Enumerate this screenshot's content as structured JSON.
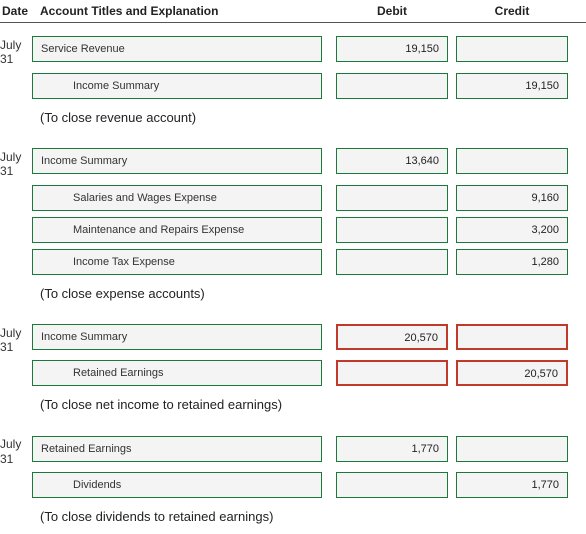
{
  "headers": {
    "date": "Date",
    "acct": "Account Titles and Explanation",
    "debit": "Debit",
    "credit": "Credit"
  },
  "groups": [
    {
      "date": "July 31",
      "caption": "(To close revenue account)",
      "lines": [
        {
          "title": "Service Revenue",
          "indent": 0,
          "debit": "19,150",
          "credit": "",
          "error": false
        },
        {
          "title": "Income Summary",
          "indent": 1,
          "debit": "",
          "credit": "19,150",
          "error": false
        }
      ]
    },
    {
      "date": "July 31",
      "caption": "(To close expense accounts)",
      "lines": [
        {
          "title": "Income Summary",
          "indent": 0,
          "debit": "13,640",
          "credit": "",
          "error": false
        },
        {
          "title": "Salaries and Wages Expense",
          "indent": 1,
          "debit": "",
          "credit": "9,160",
          "error": false
        },
        {
          "title": "Maintenance and Repairs Expense",
          "indent": 1,
          "debit": "",
          "credit": "3,200",
          "error": false
        },
        {
          "title": "Income Tax Expense",
          "indent": 1,
          "debit": "",
          "credit": "1,280",
          "error": false
        }
      ]
    },
    {
      "date": "July 31",
      "caption": "(To close net income to retained earnings)",
      "lines": [
        {
          "title": "Income Summary",
          "indent": 0,
          "debit": "20,570",
          "credit": "",
          "error": true
        },
        {
          "title": "Retained Earnings",
          "indent": 1,
          "debit": "",
          "credit": "20,570",
          "error": true
        }
      ]
    },
    {
      "date": "July 31",
      "caption": "(To close dividends to retained earnings)",
      "lines": [
        {
          "title": "Retained Earnings",
          "indent": 0,
          "debit": "1,770",
          "credit": "",
          "error": false
        },
        {
          "title": "Dividends",
          "indent": 1,
          "debit": "",
          "credit": "1,770",
          "error": false
        }
      ]
    }
  ],
  "chart_data": {
    "type": "table",
    "title": "Closing Entries",
    "columns": [
      "Date",
      "Account Titles and Explanation",
      "Debit",
      "Credit"
    ],
    "entries": [
      {
        "date": "July 31",
        "description": "To close revenue account",
        "rows": [
          {
            "account": "Service Revenue",
            "debit": 19150,
            "credit": null
          },
          {
            "account": "Income Summary",
            "debit": null,
            "credit": 19150
          }
        ]
      },
      {
        "date": "July 31",
        "description": "To close expense accounts",
        "rows": [
          {
            "account": "Income Summary",
            "debit": 13640,
            "credit": null
          },
          {
            "account": "Salaries and Wages Expense",
            "debit": null,
            "credit": 9160
          },
          {
            "account": "Maintenance and Repairs Expense",
            "debit": null,
            "credit": 3200
          },
          {
            "account": "Income Tax Expense",
            "debit": null,
            "credit": 1280
          }
        ]
      },
      {
        "date": "July 31",
        "description": "To close net income to retained earnings",
        "rows": [
          {
            "account": "Income Summary",
            "debit": 20570,
            "credit": null
          },
          {
            "account": "Retained Earnings",
            "debit": null,
            "credit": 20570
          }
        ]
      },
      {
        "date": "July 31",
        "description": "To close dividends to retained earnings",
        "rows": [
          {
            "account": "Retained Earnings",
            "debit": 1770,
            "credit": null
          },
          {
            "account": "Dividends",
            "debit": null,
            "credit": 1770
          }
        ]
      }
    ]
  }
}
